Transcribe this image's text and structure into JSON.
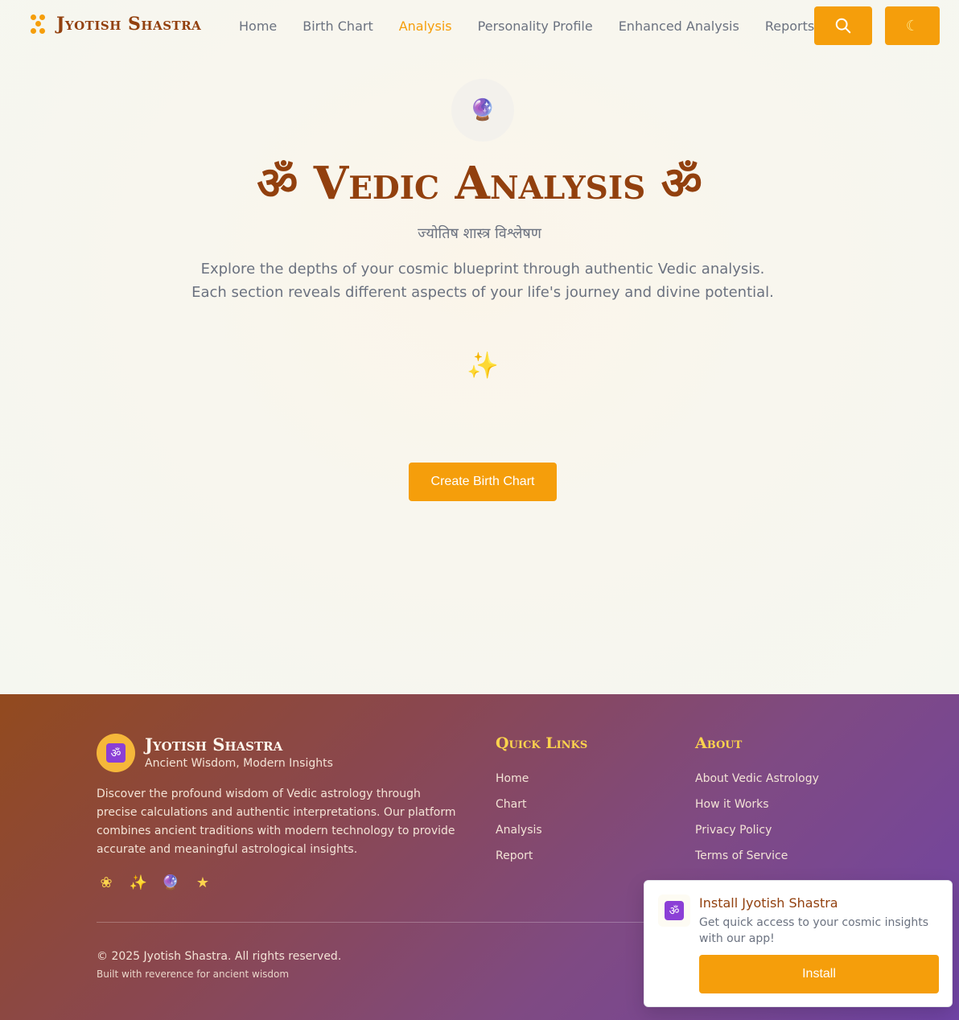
{
  "header": {
    "brand": "Jyotish Shastra",
    "nav": [
      {
        "label": "Home",
        "active": false
      },
      {
        "label": "Birth Chart",
        "active": false
      },
      {
        "label": "Analysis",
        "active": true
      },
      {
        "label": "Personality Profile",
        "active": false
      },
      {
        "label": "Enhanced Analysis",
        "active": false
      },
      {
        "label": "Reports",
        "active": false
      }
    ],
    "search_icon": "search-icon",
    "theme_icon": "moon-icon",
    "theme_glyph": "☾"
  },
  "hero": {
    "orb_icon": "crystal-ball-icon",
    "orb_glyph": "🔮",
    "title": "ॐ Vedic Analysis ॐ",
    "subtitle": "ज्योतिष शास्त्र विश्लेषण",
    "description": "Explore the depths of your cosmic blueprint through authentic Vedic analysis. Each section reveals different aspects of your life's journey and divine potential.",
    "star_icon": "glowing-star-icon",
    "star_glyph": "✨",
    "cta_label": "Create Birth Chart"
  },
  "footer": {
    "brand": "Jyotish Shastra",
    "om_glyph": "ॐ",
    "tagline": "Ancient Wisdom, Modern Insights",
    "description": "Discover the profound wisdom of Vedic astrology through precise calculations and authentic interpretations. Our platform combines ancient traditions with modern technology to provide accurate and meaningful astrological insights.",
    "icons": [
      {
        "name": "lotus-icon",
        "glyph": "❀"
      },
      {
        "name": "glowing-star-icon",
        "glyph": "✨"
      },
      {
        "name": "crystal-ball-icon",
        "glyph": "🔮"
      },
      {
        "name": "star-icon",
        "glyph": "★"
      }
    ],
    "quick_links_title": "Quick Links",
    "quick_links": [
      "Home",
      "Chart",
      "Analysis",
      "Report"
    ],
    "about_title": "About",
    "about_links": [
      "About Vedic Astrology",
      "How it Works",
      "Privacy Policy",
      "Terms of Service"
    ],
    "copyright": "© 2025 Jyotish Shastra. All rights reserved.",
    "built_with": "Built with reverence for ancient wisdom"
  },
  "install_prompt": {
    "icon_glyph": "ॐ",
    "title": "Install Jyotish Shastra",
    "description": "Get quick access to your cosmic insights with our app!",
    "button_label": "Install"
  },
  "colors": {
    "accent": "#f59e0b",
    "brand_text": "#92400e",
    "footer_gold": "#fcd34d",
    "om_purple": "#8b3fd6"
  }
}
